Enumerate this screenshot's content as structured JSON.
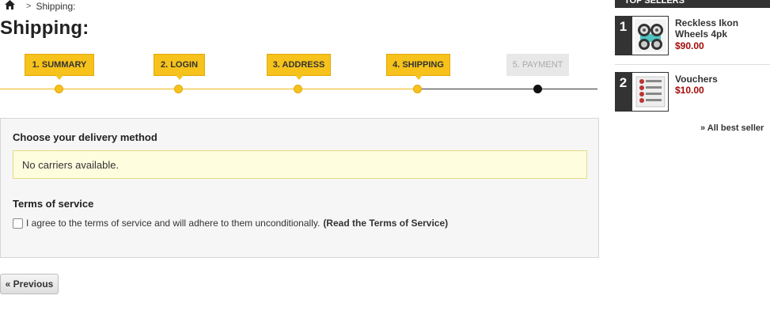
{
  "breadcrumb": {
    "current": "Shipping:"
  },
  "page": {
    "title": "Shipping:"
  },
  "steps": [
    {
      "label": "1. SUMMARY"
    },
    {
      "label": "2. LOGIN"
    },
    {
      "label": "3. ADDRESS"
    },
    {
      "label": "4. SHIPPING"
    },
    {
      "label": "5. PAYMENT"
    }
  ],
  "delivery": {
    "heading": "Choose your delivery method",
    "warning": "No carriers available."
  },
  "terms": {
    "heading": "Terms of service",
    "agree_text": "I agree to the terms of service and will adhere to them unconditionally.",
    "link_text": "(Read the Terms of Service)"
  },
  "buttons": {
    "previous": "« Previous"
  },
  "sidebar": {
    "header": "TOP SELLERS",
    "items": [
      {
        "rank": "1",
        "name": "Reckless Ikon Wheels 4pk",
        "price": "$90.00",
        "icon": "wheels-product-icon"
      },
      {
        "rank": "2",
        "name": "Vouchers",
        "price": "$10.00",
        "icon": "voucher-product-icon"
      }
    ],
    "all_link": "» All best seller"
  },
  "colors": {
    "accent": "#f6c21b",
    "price": "#a50a0a",
    "dark": "#333333"
  }
}
